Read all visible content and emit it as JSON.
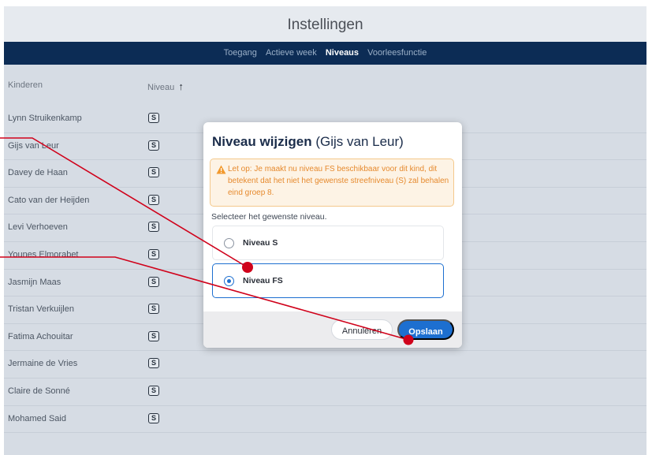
{
  "header": {
    "title": "Instellingen"
  },
  "nav": {
    "tabs": [
      {
        "label": "Toegang"
      },
      {
        "label": "Actieve week"
      },
      {
        "label": "Niveaus"
      },
      {
        "label": "Voorleesfunctie"
      }
    ],
    "active_tab": "Niveaus"
  },
  "table": {
    "col_children": "Kinderen",
    "col_level": "Niveau",
    "sort_icon": "arrow-up-icon",
    "rows": [
      {
        "name": "Lynn Struikenkamp",
        "level": "S"
      },
      {
        "name": "Gijs van Leur",
        "level": "S"
      },
      {
        "name": "Davey de Haan",
        "level": "S"
      },
      {
        "name": "Cato van der Heijden",
        "level": "S"
      },
      {
        "name": "Levi Verhoeven",
        "level": "S"
      },
      {
        "name": "Younes Elmorabet",
        "level": "S"
      },
      {
        "name": "Jasmijn Maas",
        "level": "S"
      },
      {
        "name": "Tristan Verkuijlen",
        "level": "S"
      },
      {
        "name": "Fatima Achouitar",
        "level": "S"
      },
      {
        "name": "Jermaine de Vries",
        "level": "S"
      },
      {
        "name": "Claire de Sonné",
        "level": "S"
      },
      {
        "name": "Mohamed Said",
        "level": "S"
      }
    ]
  },
  "modal": {
    "title": "Niveau wijzigen",
    "subtitle": "(Gijs van Leur)",
    "warning": "Let op: Je maakt nu niveau FS beschikbaar voor dit kind, dit betekent dat het niet het gewenste streefniveau (S) zal behalen eind groep 8.",
    "prompt": "Selecteer het gewenste niveau.",
    "options": [
      {
        "label": "Niveau S",
        "selected": false
      },
      {
        "label": "Niveau FS",
        "selected": true
      }
    ],
    "cancel_label": "Annuleren",
    "save_label": "Opslaan"
  },
  "colors": {
    "nav_bg": "#0c2c55",
    "accent": "#1d6fd0",
    "warning": "#e68a2e",
    "annotation": "#d0021b"
  }
}
